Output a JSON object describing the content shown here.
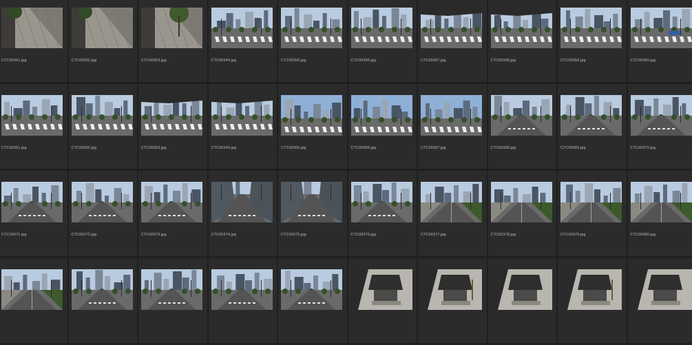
{
  "browser": {
    "thumbnails": [
      {
        "filename": "CTC00351.jpg",
        "scene": "sidewalk"
      },
      {
        "filename": "CTC00352.jpg",
        "scene": "sidewalk"
      },
      {
        "filename": "CTC00353.jpg",
        "scene": "sidewalk-trees"
      },
      {
        "filename": "CTC00354.jpg",
        "scene": "intersection-sky"
      },
      {
        "filename": "CTC00355.jpg",
        "scene": "intersection-sky"
      },
      {
        "filename": "CTC00356.jpg",
        "scene": "intersection-sky"
      },
      {
        "filename": "CTC00357.jpg",
        "scene": "intersection-overpass"
      },
      {
        "filename": "CTC00358.jpg",
        "scene": "intersection-overpass"
      },
      {
        "filename": "CTC00359.jpg",
        "scene": "intersection-sky"
      },
      {
        "filename": "CTC00360.jpg",
        "scene": "intersection-car"
      },
      {
        "filename": "CTC00361.jpg",
        "scene": "street-trees"
      },
      {
        "filename": "CTC00362.jpg",
        "scene": "street-trees"
      },
      {
        "filename": "CTC00363.jpg",
        "scene": "overpass-street"
      },
      {
        "filename": "CTC00364.jpg",
        "scene": "overpass-street"
      },
      {
        "filename": "CTC00365.jpg",
        "scene": "towers-blue"
      },
      {
        "filename": "CTC00366.jpg",
        "scene": "towers-blue"
      },
      {
        "filename": "CTC00367.jpg",
        "scene": "towers-blue"
      },
      {
        "filename": "CTC00368.jpg",
        "scene": "boulevard-gray"
      },
      {
        "filename": "CTC00369.jpg",
        "scene": "boulevard-gray"
      },
      {
        "filename": "CTC00370.jpg",
        "scene": "boulevard-gray"
      },
      {
        "filename": "CTC00371.jpg",
        "scene": "boulevard"
      },
      {
        "filename": "CTC00372.jpg",
        "scene": "boulevard"
      },
      {
        "filename": "CTC00373.jpg",
        "scene": "boulevard"
      },
      {
        "filename": "CTC00374.jpg",
        "scene": "canyon"
      },
      {
        "filename": "CTC00375.jpg",
        "scene": "canyon"
      },
      {
        "filename": "CTC00376.jpg",
        "scene": "boulevard"
      },
      {
        "filename": "CTC00377.jpg",
        "scene": "empty-road"
      },
      {
        "filename": "CTC00378.jpg",
        "scene": "empty-road"
      },
      {
        "filename": "CTC00379.jpg",
        "scene": "empty-road"
      },
      {
        "filename": "CTC00380.jpg",
        "scene": "empty-road"
      },
      {
        "filename": "",
        "scene": "empty-road"
      },
      {
        "filename": "",
        "scene": "boulevard"
      },
      {
        "filename": "",
        "scene": "boulevard"
      },
      {
        "filename": "",
        "scene": "boulevard"
      },
      {
        "filename": "",
        "scene": "boulevard"
      },
      {
        "filename": "",
        "scene": "kiosk"
      },
      {
        "filename": "",
        "scene": "kiosk"
      },
      {
        "filename": "",
        "scene": "kiosk"
      },
      {
        "filename": "",
        "scene": "kiosk"
      },
      {
        "filename": "",
        "scene": "kiosk"
      }
    ]
  }
}
